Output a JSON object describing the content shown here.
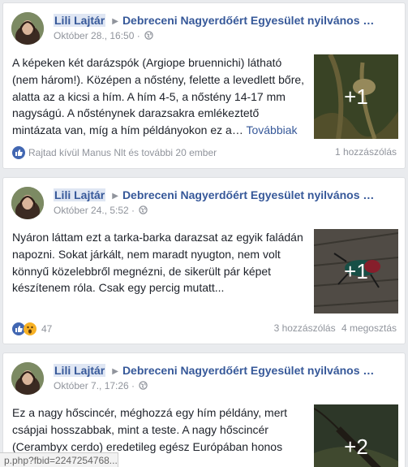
{
  "posts": [
    {
      "author": "Lili Lajtár",
      "group": "Debreceni Nagyerdőért Egyesület nyilvános …",
      "time": "Október 28., 16:50 · ",
      "text": "A képeken két darázspók (Argiope bruennichi) látható (nem három!). Középen a nőstény, felette a levedlett bőre, alatta az a kicsi a hím. A hím 4-5, a nőstény 14-17 mm nagyságú. A nősténynek darazsakra emlékeztető mintázata van, míg a hím példányokon ez a…",
      "more": "Továbbiak",
      "extra_photos": "+1",
      "reactions": "Rajtad kívül Manus Nlt és további 20 ember",
      "comments": "1 hozzászólás",
      "shares": ""
    },
    {
      "author": "Lili Lajtár",
      "group": "Debreceni Nagyerdőért Egyesület nyilvános …",
      "time": "Október 24., 5:52 · ",
      "text": "Nyáron láttam ezt a tarka-barka darazsat az egyik faládán napozni. Sokat járkált, nem maradt nyugton, nem volt könnyű közelebbről megnézni, de sikerült pár képet készítenem róla. Csak egy percig mutatt...",
      "more": "",
      "extra_photos": "+1",
      "reactions": "47",
      "comments": "3 hozzászólás",
      "shares": "4 megosztás"
    },
    {
      "author": "Lili Lajtár",
      "group": "Debreceni Nagyerdőért Egyesület nyilvános …",
      "time": "Október 7., 17:26 · ",
      "text": "Ez a nagy hőscincér, méghozzá egy hím példány, mert csápjai hosszabbak, mint a teste. A nagy hőscincér (Cerambyx cerdo) eredetileg egész Európában honos",
      "more": "",
      "extra_photos": "+2",
      "reactions": "",
      "comments": "",
      "shares": ""
    }
  ],
  "status_url": "p.php?fbid=2247254768...",
  "colors": {
    "link": "#365899",
    "meta": "#90949c",
    "text": "#1d2129",
    "like_blue": "#4267b2",
    "wow_yellow": "#f7b125"
  },
  "icons": [
    "globe-icon",
    "like-icon",
    "wow-icon",
    "share-arrow-icon"
  ]
}
